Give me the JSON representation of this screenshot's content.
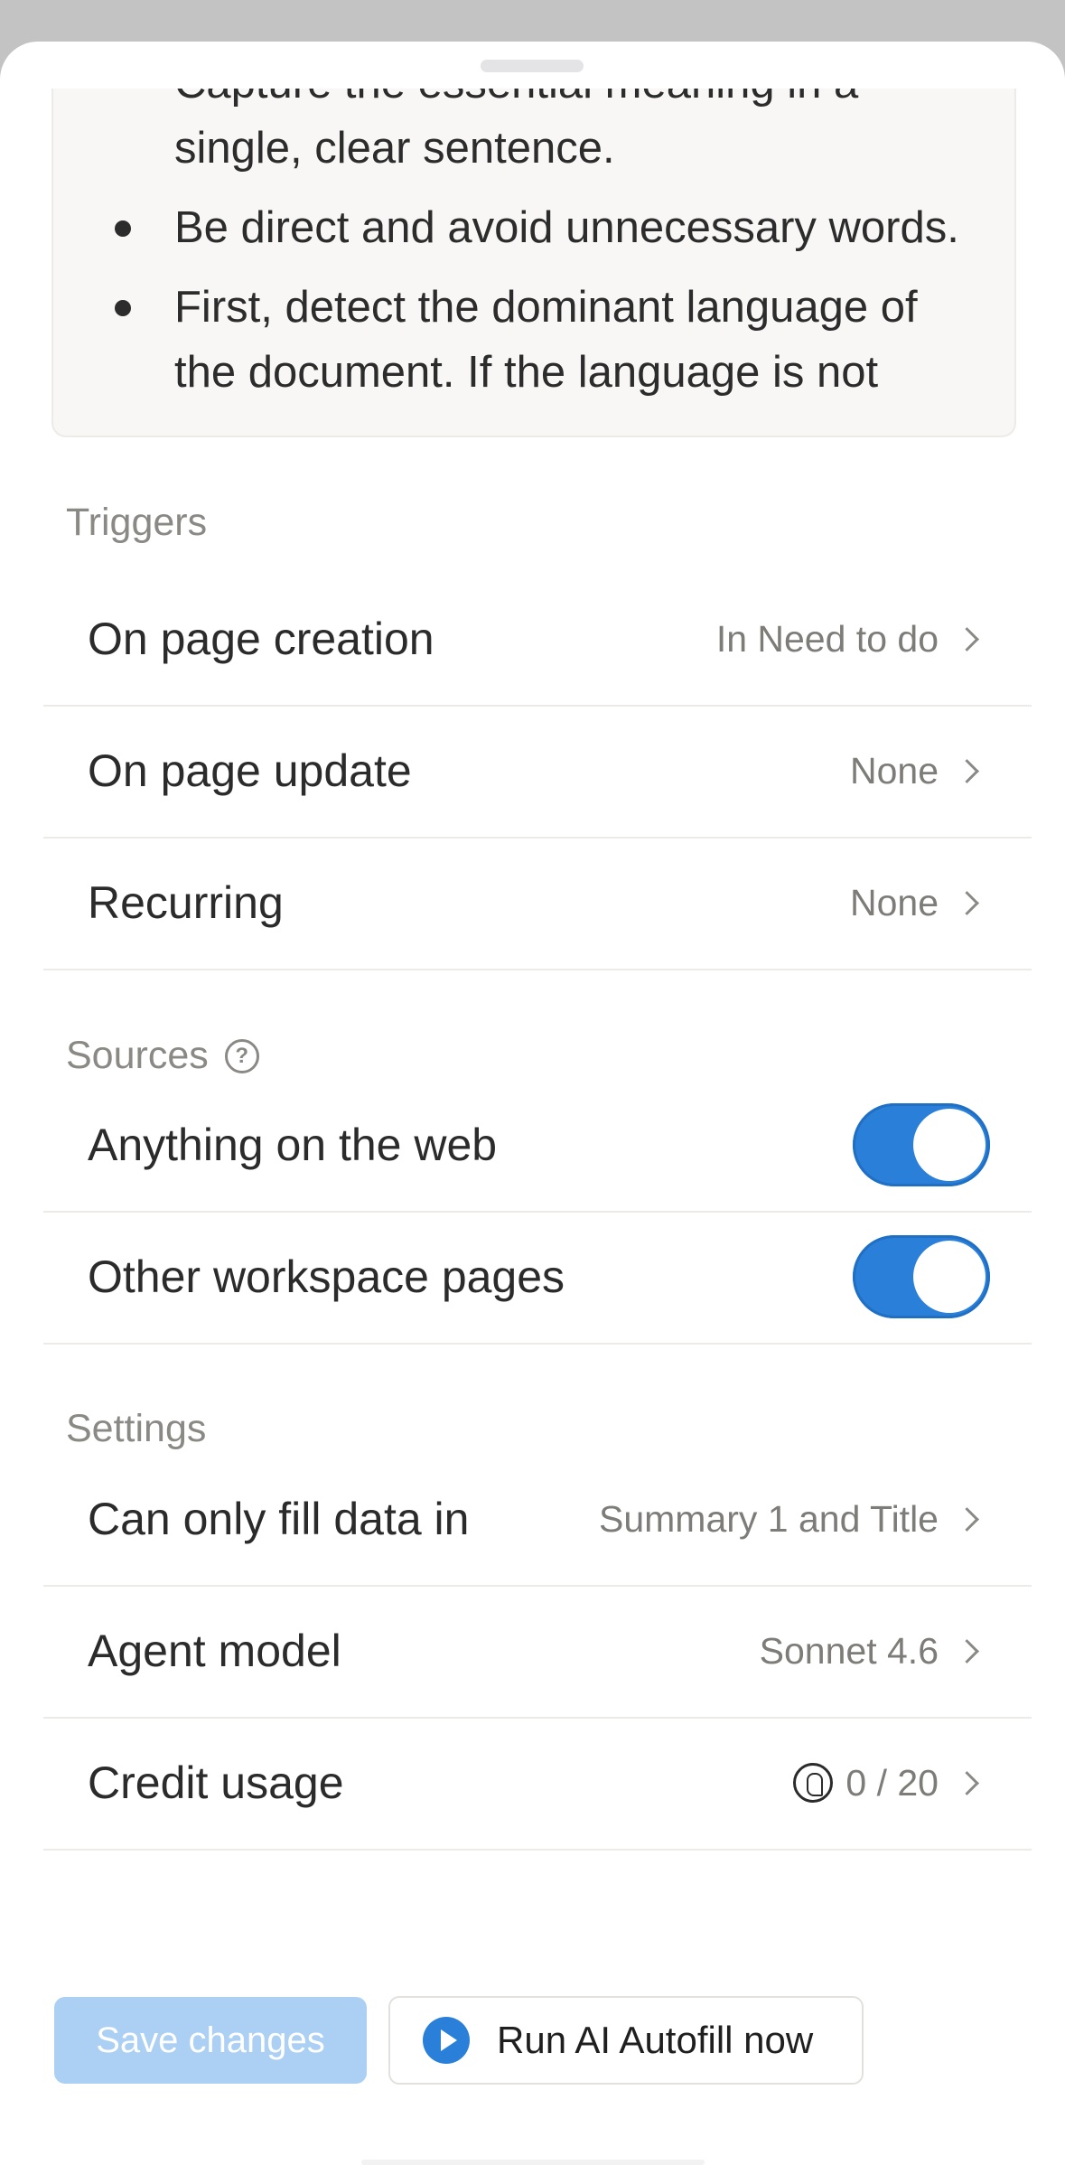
{
  "prompt": {
    "bullets": [
      {
        "text": "Capture the essential meaning in a single, clear sentence.",
        "dot": false
      },
      {
        "text": "Be direct and avoid unnecessary words.",
        "dot": true
      },
      {
        "text": "First, detect the dominant language of the document. If the language is not",
        "dot": true
      }
    ]
  },
  "triggers": {
    "heading": "Triggers",
    "on_page_creation": {
      "label": "On page creation",
      "value": "In Need to do"
    },
    "on_page_update": {
      "label": "On page update",
      "value": "None"
    },
    "recurring": {
      "label": "Recurring",
      "value": "None"
    }
  },
  "sources": {
    "heading": "Sources",
    "help_glyph": "?",
    "web": {
      "label": "Anything on the web",
      "enabled": true
    },
    "workspace": {
      "label": "Other workspace pages",
      "enabled": true
    }
  },
  "settings": {
    "heading": "Settings",
    "fill_data": {
      "label": "Can only fill data in",
      "value": "Summary 1 and Title"
    },
    "agent_model": {
      "label": "Agent model",
      "value": "Sonnet 4.6"
    },
    "credit_usage": {
      "label": "Credit usage",
      "value": "0 / 20"
    }
  },
  "actions": {
    "save_label": "Save changes",
    "run_label": "Run AI Autofill now"
  },
  "colors": {
    "accent": "#2a7fd9",
    "save_disabled": "#acd0f3"
  }
}
